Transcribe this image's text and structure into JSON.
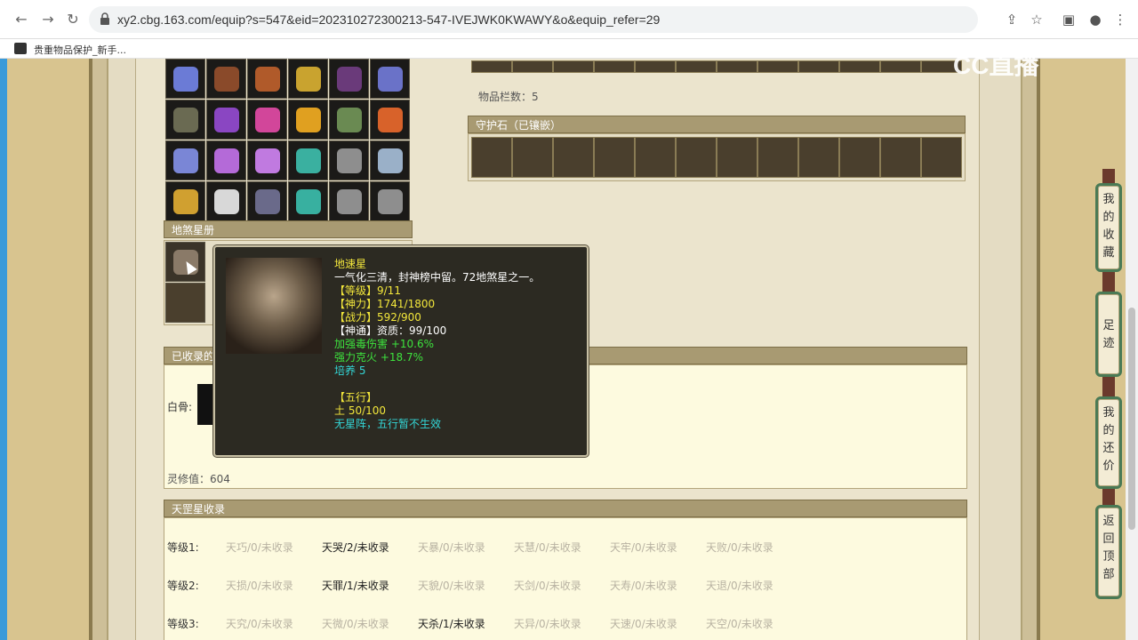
{
  "browser": {
    "url": "xy2.cbg.163.com/equip?s=547&eid=202310272300213-547-IVEJWK0KWAWY&o&equip_refer=29",
    "bookmark": "贵重物品保护_新手..."
  },
  "watermark": "CC直播",
  "inventory": {
    "count_label": "物品栏数：5"
  },
  "guard_stone": {
    "header": "守护石（已镶嵌）"
  },
  "earth_star": {
    "header": "地煞星册"
  },
  "collected": {
    "header": "已收录的",
    "row_label": "白骨:",
    "lingxiu": "灵修值：604"
  },
  "tooltip": {
    "name": "地速星",
    "desc": "一气化三清，封神榜中留。72地煞星之一。",
    "level": "【等级】9/11",
    "shenli": "【神力】1741/1800",
    "zhanli": "【战力】592/900",
    "shentong": "【神通】资质：99/100",
    "attr1": "加强毒伤害 +10.6%",
    "attr2": "强力克火 +18.7%",
    "cultivate": "培养 5",
    "wuxing_title": "【五行】",
    "wuxing_value": "土 50/100",
    "wuxing_note": "无星阵，五行暂不生效"
  },
  "tiangang": {
    "header": "天罡星收录",
    "rows": [
      {
        "label": "等级1:",
        "cells": [
          "天巧/0/未收录",
          "天哭/2/未收录",
          "天暴/0/未收录",
          "天慧/0/未收录",
          "天牢/0/未收录",
          "天败/0/未收录"
        ]
      },
      {
        "label": "等级2:",
        "cells": [
          "天损/0/未收录",
          "天罪/1/未收录",
          "天貌/0/未收录",
          "天剑/0/未收录",
          "天寿/0/未收录",
          "天退/0/未收录"
        ]
      },
      {
        "label": "等级3:",
        "cells": [
          "天究/0/未收录",
          "天微/0/未收录",
          "天杀/1/未收录",
          "天异/0/未收录",
          "天速/0/未收录",
          "天空/0/未收录"
        ]
      }
    ]
  },
  "float_buttons": [
    "我的收藏",
    "足迹",
    "我的还价",
    "返回顶部"
  ]
}
